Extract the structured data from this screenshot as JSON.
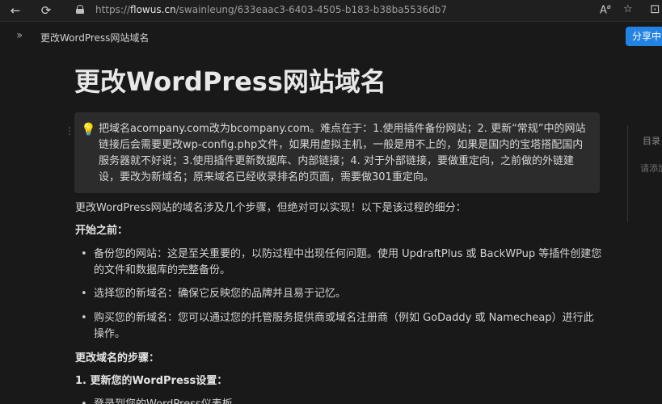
{
  "browser": {
    "url_prefix": "https://",
    "url_host": "flowus.cn",
    "url_path": "/swainleung/633eaac3-6403-4505-b183-b38ba5536db7"
  },
  "header": {
    "breadcrumb": "更改WordPress网站域名",
    "share_label": "分享中"
  },
  "page": {
    "title": "更改WordPress网站域名",
    "callout": "把域名acompany.com改为bcompany.com。难点在于：1.使用插件备份网站；2. 更新“常规”中的网站链接后会需要更改wp-config.php文件，如果用虚拟主机，一般是用不上的，如果是国内的宝塔搭配国内服务器就不好说；3.使用插件更新数据库、内部链接；4. 对于外部链接，要做重定向，之前做的外链建设，要改为新域名；原来域名已经收录排名的页面，需要做301重定向。",
    "intro": "更改WordPress网站的域名涉及几个步骤，但绝对可以实现！以下是该过程的细分：",
    "before_heading": "开始之前：",
    "before_items": [
      "备份您的网站：这是至关重要的，以防过程中出现任何问题。使用 UpdraftPlus 或 BackWPup 等插件创建您的文件和数据库的完整备份。",
      "选择您的新域名：确保它反映您的品牌并且易于记忆。",
      "购买您的新域名：您可以通过您的托管服务提供商或域名注册商（例如 GoDaddy 或 Namecheap）进行此操作。"
    ],
    "steps_heading": "更改域名的步骤：",
    "step1_heading": "1. 更新您的WordPress设置：",
    "step1_item": "登录到您的WordPress仪表板"
  },
  "toc": {
    "title": "目录",
    "hint": "请添加"
  }
}
